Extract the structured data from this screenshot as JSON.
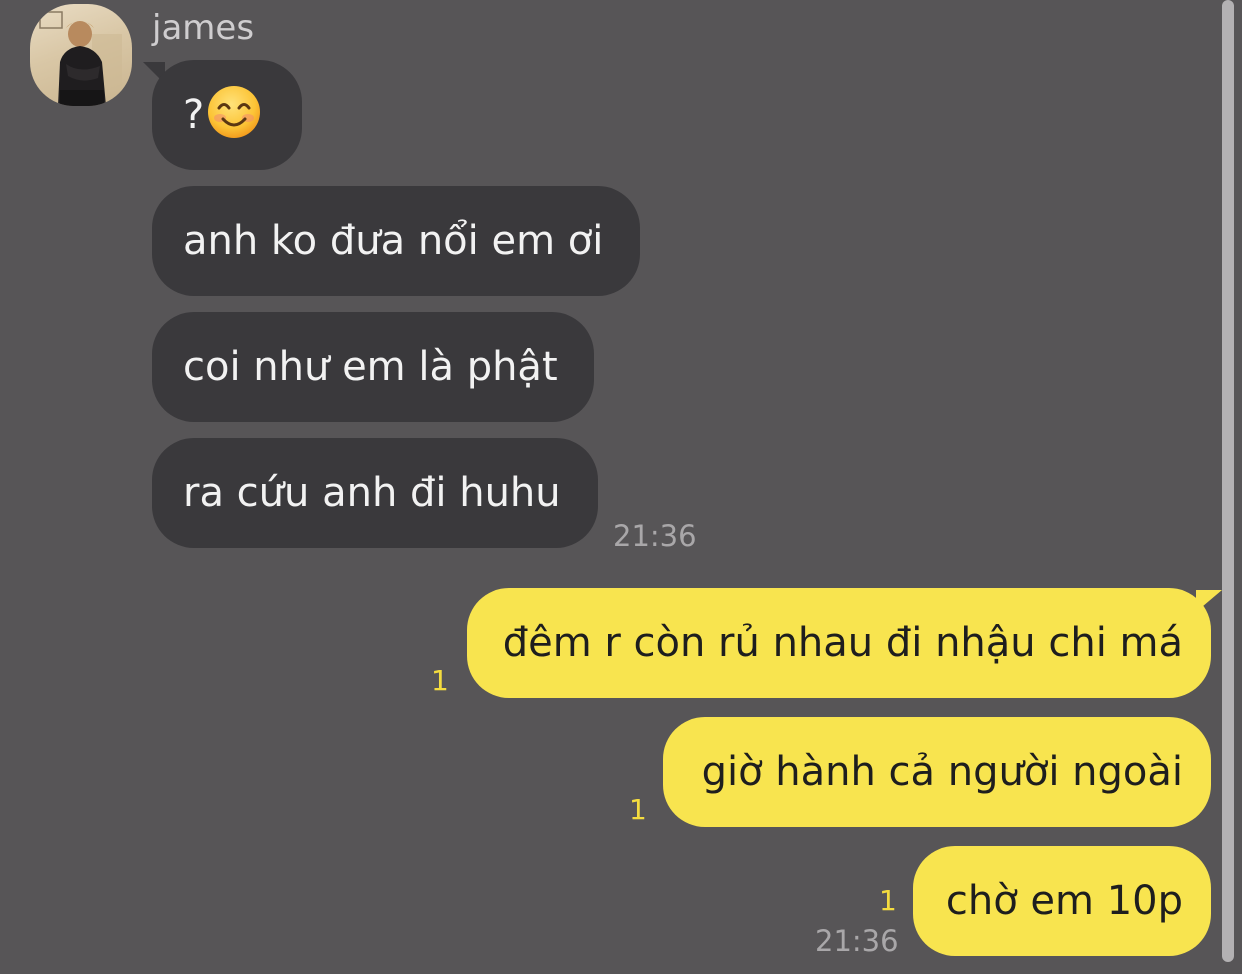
{
  "contact": {
    "name": "james",
    "avatar_icon": "contact-avatar"
  },
  "incoming": [
    {
      "text": "?",
      "emoji": "smiling-face-emoji"
    },
    {
      "text": "anh ko đưa nổi em ơi"
    },
    {
      "text": "coi như em là phật"
    },
    {
      "text": "ra cứu anh đi huhu"
    }
  ],
  "incoming_time": "21:36",
  "outgoing": [
    {
      "text": "đêm r còn rủ nhau đi nhậu chi má",
      "unread": "1"
    },
    {
      "text": "giờ hành cả người ngoài",
      "unread": "1"
    },
    {
      "text": "chờ em 10p",
      "unread": "1"
    }
  ],
  "outgoing_time": "21:36",
  "colors": {
    "background": "#575557",
    "incoming_bubble": "#3a393c",
    "outgoing_bubble": "#f8e44f",
    "unread_count": "#f4dc3f"
  }
}
